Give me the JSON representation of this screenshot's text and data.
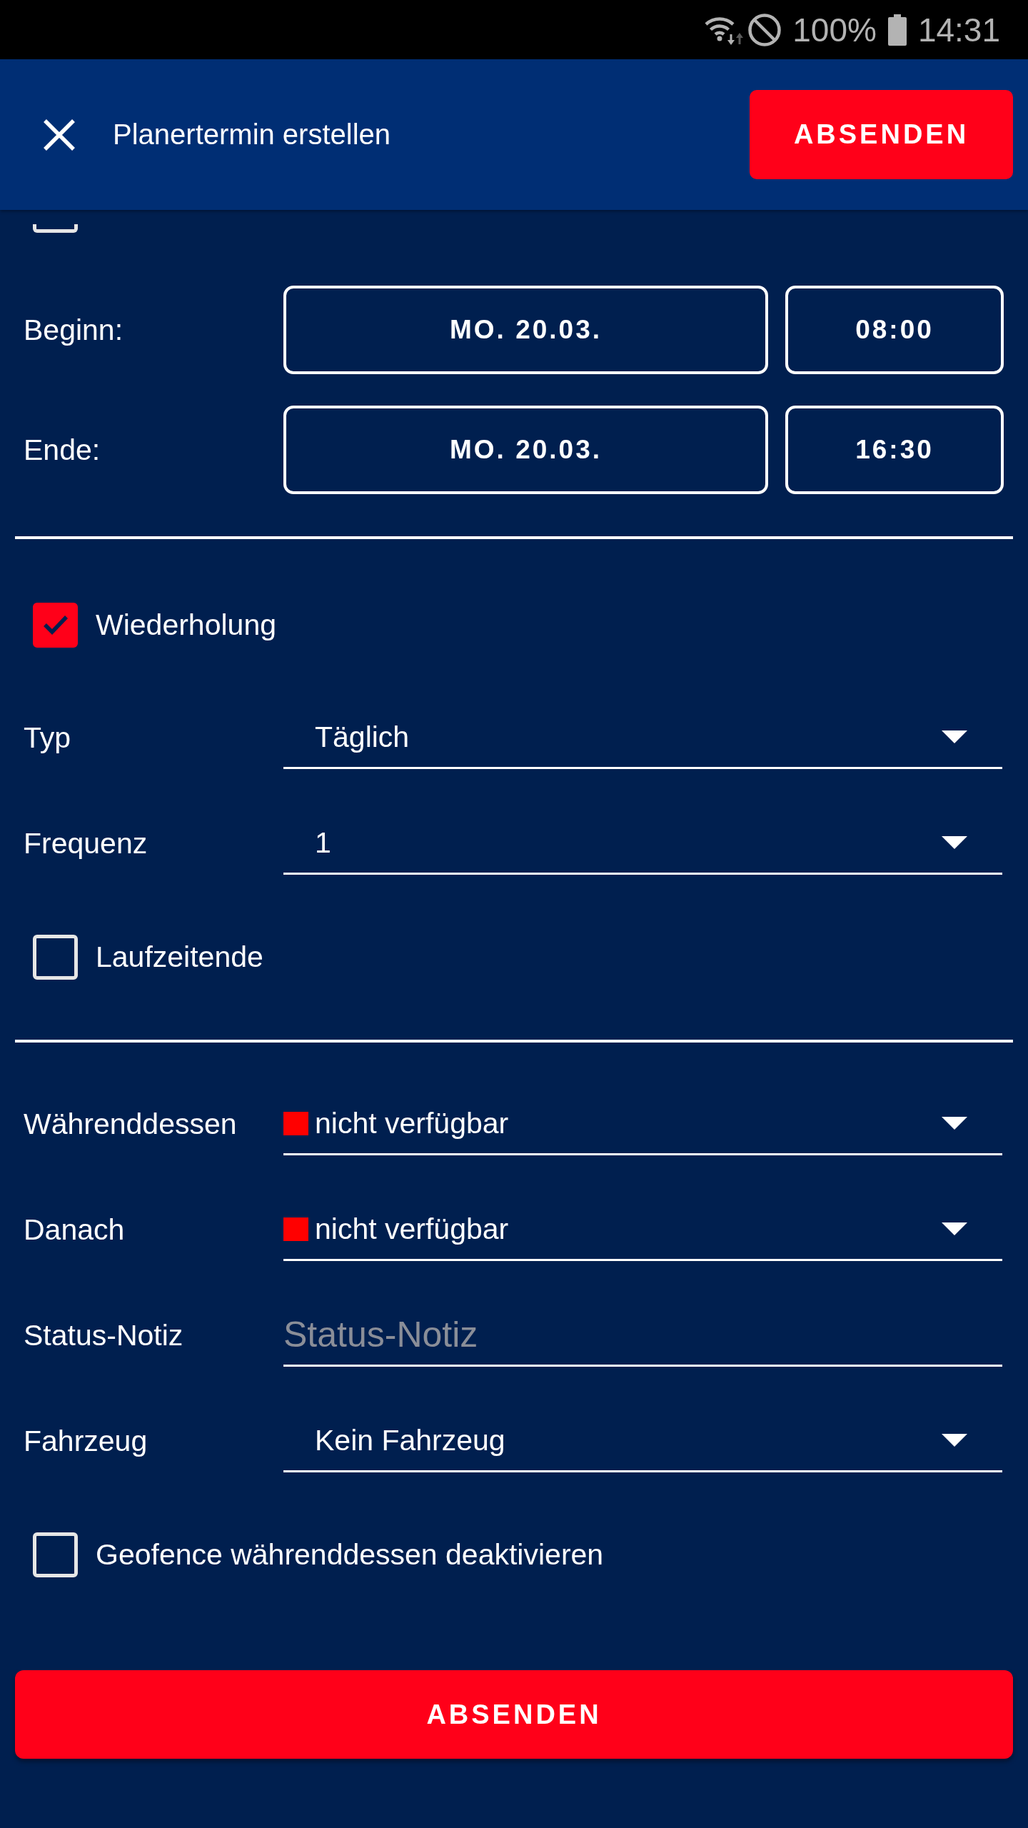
{
  "status_bar": {
    "battery": "100%",
    "time": "14:31"
  },
  "header": {
    "title": "Planertermin erstellen",
    "submit": "ABSENDEN"
  },
  "partial_checkbox": {
    "checked": false
  },
  "schedule": [
    {
      "label": "Beginn:",
      "date": "MO. 20.03.",
      "time": "08:00"
    },
    {
      "label": "Ende:",
      "date": "MO. 20.03.",
      "time": "16:30"
    }
  ],
  "recurrence": [
    {
      "kind": "checkbox",
      "label": "Wiederholung",
      "checked": true
    },
    {
      "kind": "select",
      "label": "Typ",
      "value": "Täglich"
    },
    {
      "kind": "select",
      "label": "Frequenz",
      "value": "1"
    },
    {
      "kind": "checkbox",
      "label": "Laufzeitende",
      "checked": false
    }
  ],
  "status": [
    {
      "kind": "select",
      "label": "Währenddessen",
      "value": "nicht verfügbar",
      "color": "#ff0000"
    },
    {
      "kind": "select",
      "label": "Danach",
      "value": "nicht verfügbar",
      "color": "#ff0000"
    },
    {
      "kind": "text",
      "label": "Status-Notiz",
      "placeholder": "Status-Notiz"
    },
    {
      "kind": "select",
      "label": "Fahrzeug",
      "value": "Kein Fahrzeug"
    },
    {
      "kind": "checkbox",
      "label": "Geofence währenddessen deaktivieren",
      "checked": false
    }
  ],
  "submit_button": "ABSENDEN"
}
